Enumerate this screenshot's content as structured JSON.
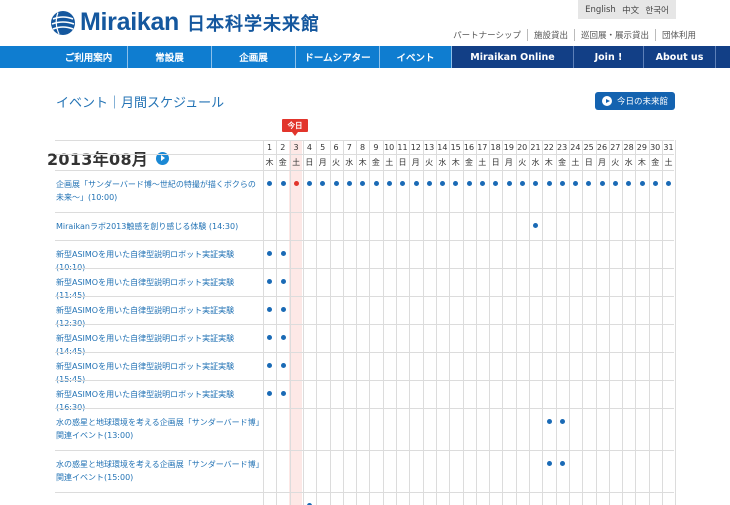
{
  "header": {
    "logo_en": "Miraikan",
    "logo_ja": "日本科学未来館",
    "languages": [
      "English",
      "中文",
      "한국어"
    ],
    "util_links": [
      "パートナーシップ",
      "施設貸出",
      "巡回展・展示貸出",
      "団体利用"
    ]
  },
  "nav": [
    {
      "label": "ご利用案内",
      "dark": false
    },
    {
      "label": "常設展",
      "dark": false
    },
    {
      "label": "企画展",
      "dark": false
    },
    {
      "label": "ドームシアター",
      "dark": false
    },
    {
      "label": "イベント",
      "dark": false
    },
    {
      "label": "Miraikan Online",
      "dark": true
    },
    {
      "label": "Join !",
      "dark": true
    },
    {
      "label": "About us",
      "dark": true
    }
  ],
  "page": {
    "title": "イベント｜月間スケジュール",
    "today_button": "今日の未来館",
    "month": "2013年08月",
    "today_tag": "今日",
    "today_day": 3
  },
  "calendar": {
    "days": [
      1,
      2,
      3,
      4,
      5,
      6,
      7,
      8,
      9,
      10,
      11,
      12,
      13,
      14,
      15,
      16,
      17,
      18,
      19,
      20,
      21,
      22,
      23,
      24,
      25,
      26,
      27,
      28,
      29,
      30,
      31
    ],
    "weekdays": [
      "木",
      "金",
      "土",
      "日",
      "月",
      "火",
      "水",
      "木",
      "金",
      "土",
      "日",
      "月",
      "火",
      "水",
      "木",
      "金",
      "土",
      "日",
      "月",
      "火",
      "水",
      "木",
      "金",
      "土",
      "日",
      "月",
      "火",
      "水",
      "木",
      "金",
      "土"
    ]
  },
  "events": [
    {
      "title": "企画展「サンダーバード博〜世紀の特撮が描くボクらの未来〜」(10:00)",
      "lines": 2,
      "days": [
        1,
        2,
        3,
        4,
        5,
        6,
        7,
        8,
        9,
        10,
        11,
        12,
        13,
        14,
        15,
        16,
        17,
        18,
        19,
        20,
        21,
        22,
        23,
        24,
        25,
        26,
        27,
        28,
        29,
        30,
        31
      ]
    },
    {
      "title": "Miraikanラボ2013触感を創り感じる体験 (14:30)",
      "lines": 1,
      "days": [
        21
      ]
    },
    {
      "title": "新型ASIMOを用いた自律型説明ロボット実証実験(10:10)",
      "lines": 1,
      "days": [
        1,
        2
      ]
    },
    {
      "title": "新型ASIMOを用いた自律型説明ロボット実証実験(11:45)",
      "lines": 1,
      "days": [
        1,
        2
      ]
    },
    {
      "title": "新型ASIMOを用いた自律型説明ロボット実証実験(12:30)",
      "lines": 1,
      "days": [
        1,
        2
      ]
    },
    {
      "title": "新型ASIMOを用いた自律型説明ロボット実証実験(14:45)",
      "lines": 1,
      "days": [
        1,
        2
      ]
    },
    {
      "title": "新型ASIMOを用いた自律型説明ロボット実証実験(15:45)",
      "lines": 1,
      "days": [
        1,
        2
      ]
    },
    {
      "title": "新型ASIMOを用いた自律型説明ロボット実証実験(16:30)",
      "lines": 1,
      "days": [
        1,
        2
      ]
    },
    {
      "title": "水の惑星と地球環境を考える企画展「サンダーバード博」関連イベント(13:00)",
      "lines": 2,
      "days": [
        22,
        23
      ]
    },
    {
      "title": "水の惑星と地球環境を考える企画展「サンダーバード博」関連イベント(15:00)",
      "lines": 2,
      "days": [
        22,
        23
      ]
    },
    {
      "title": "",
      "lines": 1,
      "days": [
        4
      ]
    }
  ]
}
